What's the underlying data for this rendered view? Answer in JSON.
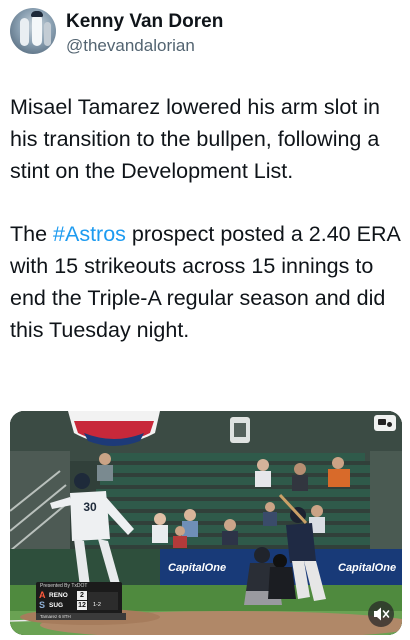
{
  "author": {
    "display_name": "Kenny Van Doren",
    "handle": "@thevandalorian",
    "avatar_icon": "profile-photo-baseball-players"
  },
  "tweet": {
    "paragraph1": "Misael Tamarez lowered his arm slot in his transition to the bullpen, following a stint on the Development List.",
    "paragraph2_before": "The ",
    "hashtag": "#Astros",
    "paragraph2_after": " prospect posted a 2.40 ERA with 15 strikeouts across 15 innings to end the Triple-A regular season and did this Tuesday night."
  },
  "media": {
    "type": "video",
    "outfield_ads": [
      "CapitalOne",
      "CapitalOne"
    ],
    "pitcher_jersey_number": "30",
    "scorebug": {
      "presented_by": "Presented By TxDOT",
      "teams": [
        {
          "name": "RENO",
          "score": "2"
        },
        {
          "name": "SUG",
          "score": "12"
        }
      ],
      "count": "1-2",
      "bottom_text": "Tamarez 6     8TH"
    },
    "mute_icon": "speaker-muted-icon",
    "gif_icon": "media-badge-icon",
    "colors": {
      "hashtag": "#1d9bf0",
      "handle": "#536471"
    }
  }
}
